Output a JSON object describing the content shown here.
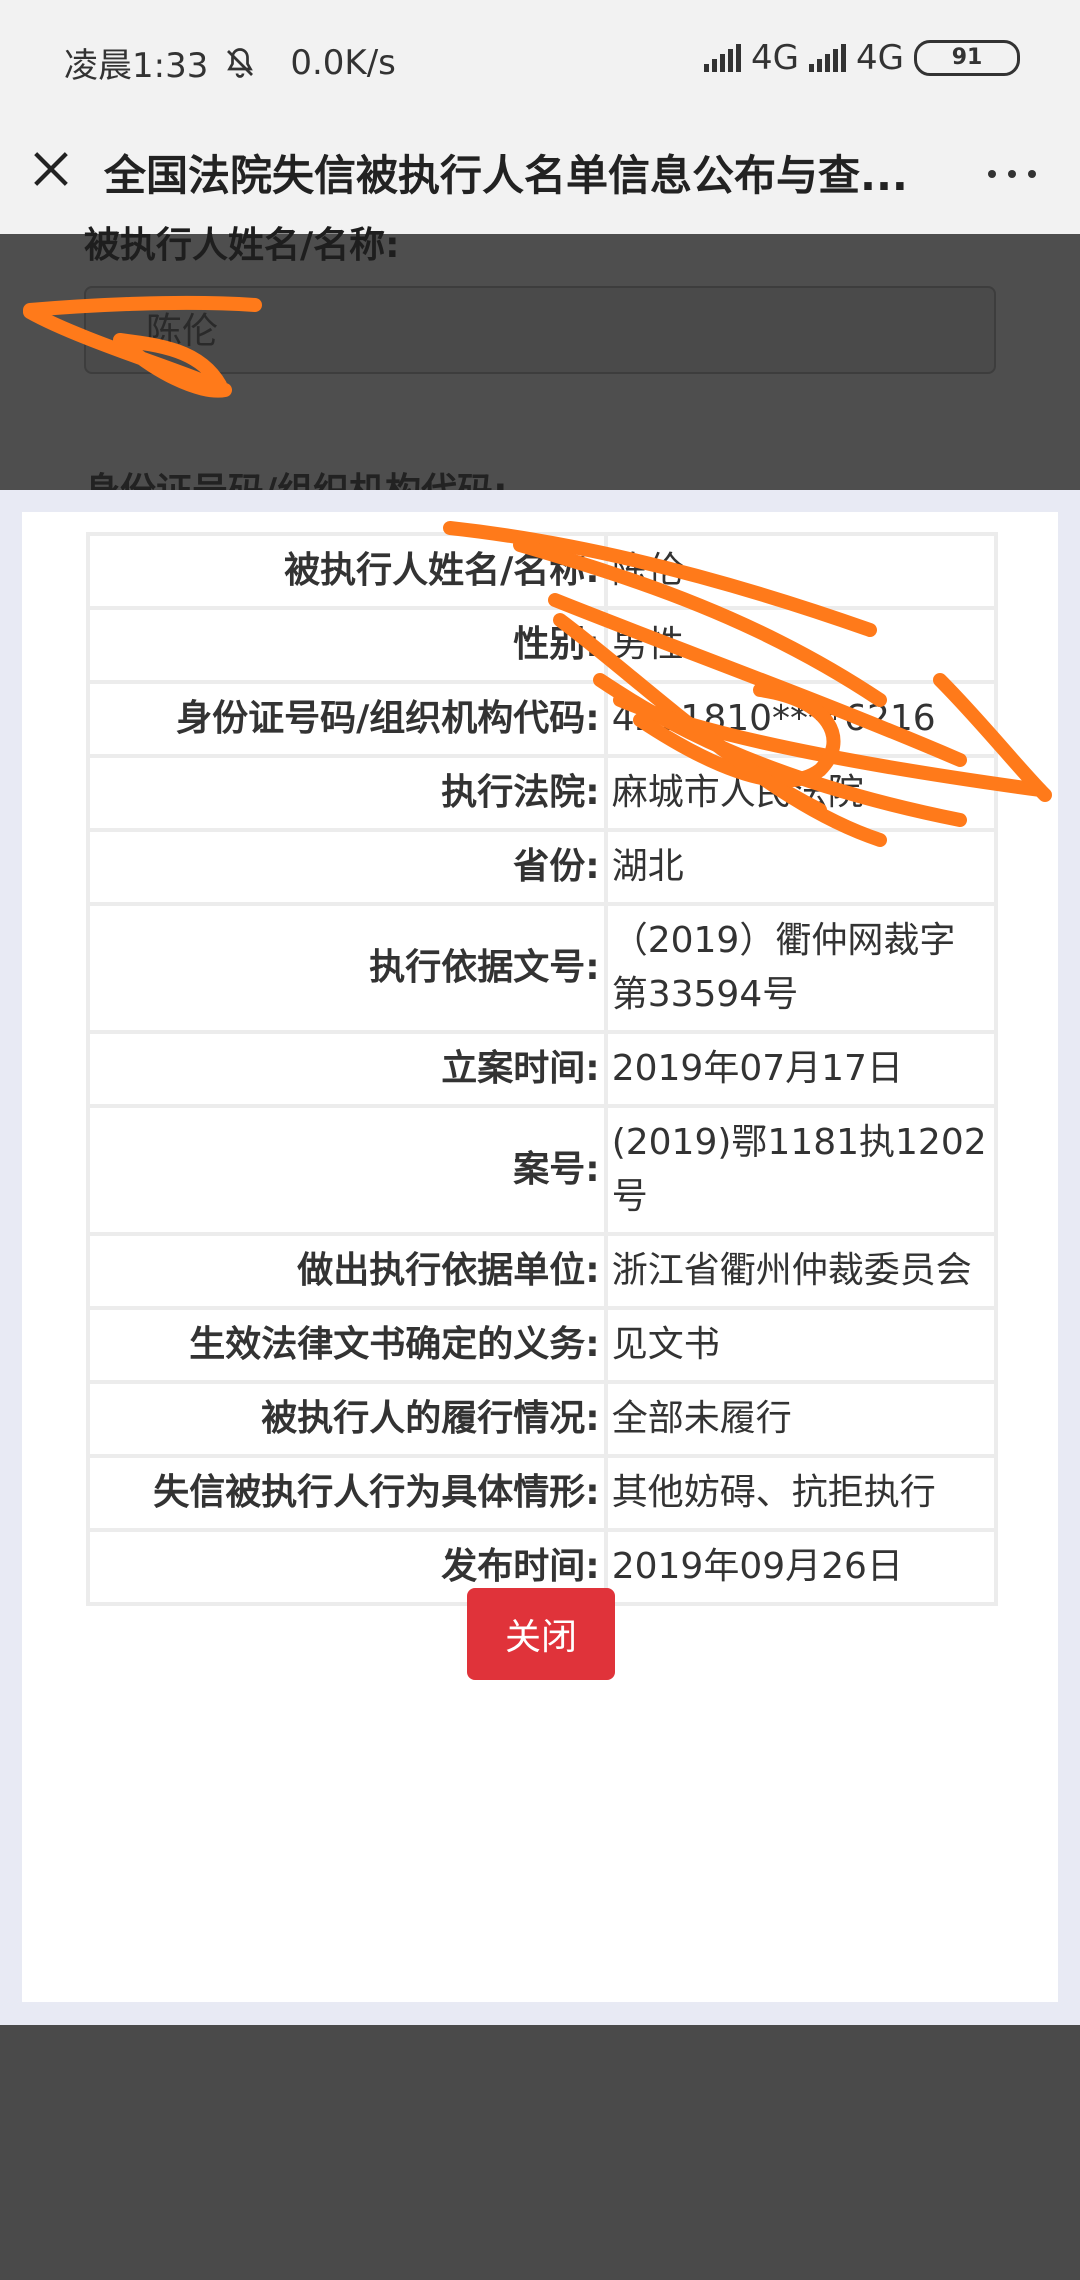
{
  "status_bar": {
    "time": "凌晨1:33",
    "net_speed": "0.0K/s",
    "network1": "4G",
    "network2": "4G",
    "battery": "91"
  },
  "title_bar": {
    "title": "全国法院失信被执行人名单信息公布与查..."
  },
  "background_form": {
    "name_label": "被执行人姓名/名称:",
    "name_value": "陈伦",
    "id_label": "身份证号码/组织机构代码:"
  },
  "details": {
    "rows": [
      {
        "key": "被执行人姓名/名称:",
        "value": "陈伦"
      },
      {
        "key": "性别:",
        "value": "男性"
      },
      {
        "key": "身份证号码/组织机构代码:",
        "value": "4211810****6216"
      },
      {
        "key": "执行法院:",
        "value": "麻城市人民法院"
      },
      {
        "key": "省份:",
        "value": "湖北"
      },
      {
        "key": "执行依据文号:",
        "value": "（2019）衢仲网裁字第33594号"
      },
      {
        "key": "立案时间:",
        "value": "2019年07月17日"
      },
      {
        "key": "案号:",
        "value": "(2019)鄂1181执1202号"
      },
      {
        "key": "做出执行依据单位:",
        "value": "浙江省衢州仲裁委员会"
      },
      {
        "key": "生效法律文书确定的义务:",
        "value": "见文书"
      },
      {
        "key": "被执行人的履行情况:",
        "value": "全部未履行"
      },
      {
        "key": "失信被执行人行为具体情形:",
        "value": "其他妨碍、抗拒执行"
      },
      {
        "key": "发布时间:",
        "value": "2019年09月26日"
      }
    ]
  },
  "actions": {
    "close_label": "关闭"
  },
  "colors": {
    "close_button": "#e0333a",
    "scribble": "#ff7a1a"
  }
}
